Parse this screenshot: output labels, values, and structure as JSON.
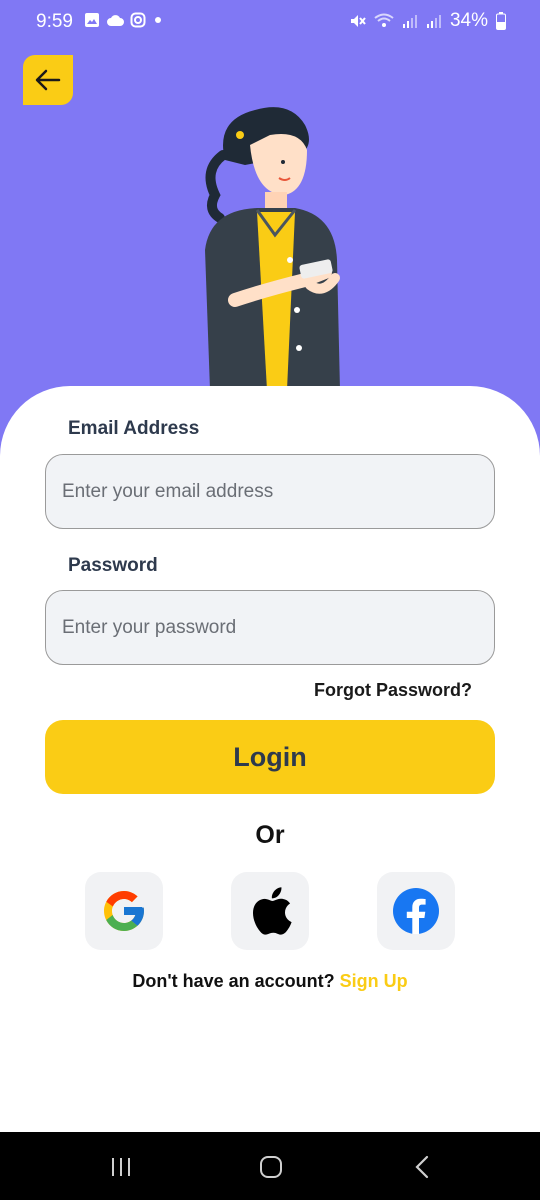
{
  "status_bar": {
    "time": "9:59",
    "battery": "34%",
    "icons": [
      "gallery-icon",
      "cloud-icon",
      "instagram-icon",
      "dot-icon",
      "mute-icon",
      "wifi-icon",
      "signal-icon",
      "signal-icon",
      "battery-icon"
    ]
  },
  "header": {
    "back_icon": "arrow-left-icon"
  },
  "form": {
    "email_label": "Email Address",
    "email_placeholder": "Enter your email address",
    "email_value": "",
    "password_label": "Password",
    "password_placeholder": "Enter your password",
    "password_value": "",
    "forgot_label": "Forgot Password?",
    "login_label": "Login",
    "or_label": "Or"
  },
  "social": {
    "google_icon": "google-icon",
    "apple_icon": "apple-icon",
    "facebook_icon": "facebook-icon"
  },
  "signup": {
    "prompt": "Don't have an account?",
    "link": "Sign Up"
  },
  "colors": {
    "header_bg": "#8078f4",
    "accent": "#facc15",
    "input_bg": "#f1f3f6",
    "label_text": "#2e3a4d"
  }
}
